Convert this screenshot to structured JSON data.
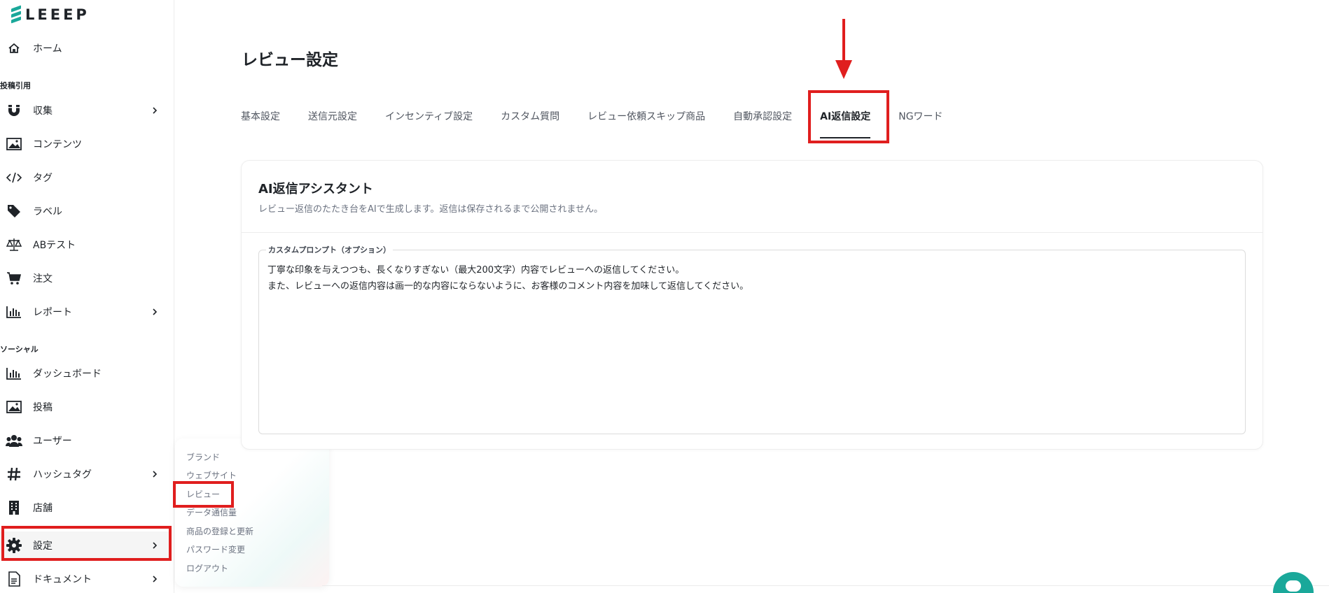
{
  "app": {
    "logo_text": "LEEEP"
  },
  "sidebar": {
    "home": "ホーム",
    "section_posts": "投稿引用",
    "collect": "収集",
    "contents": "コンテンツ",
    "tags": "タグ",
    "labels": "ラベル",
    "ab_test": "ABテスト",
    "orders": "注文",
    "reports": "レポート",
    "section_social": "ソーシャル",
    "dashboard": "ダッシュボード",
    "posts": "投稿",
    "users": "ユーザー",
    "hashtags": "ハッシュタグ",
    "stores": "店舗",
    "settings": "設定",
    "documents": "ドキュメント"
  },
  "submenu": {
    "items": [
      "ブランド",
      "ウェブサイト",
      "レビュー",
      "データ通信量",
      "商品の登録と更新",
      "パスワード変更",
      "ログアウト"
    ]
  },
  "page": {
    "title": "レビュー設定",
    "tabs": [
      "基本設定",
      "送信元設定",
      "インセンティブ設定",
      "カスタム質問",
      "レビュー依頼スキップ商品",
      "自動承認設定",
      "AI返信設定",
      "NGワード"
    ],
    "active_tab": "AI返信設定"
  },
  "card": {
    "title": "AI返信アシスタント",
    "description": "レビュー返信のたたき台をAIで生成します。返信は保存されるまで公開されません。",
    "prompt_label": "カスタムプロンプト（オプション）",
    "prompt_value": "丁寧な印象を与えつつも、長くなりすぎない（最大200文字）内容でレビューへの返信してください。\nまた、レビューへの返信内容は画一的な内容にならないように、お客様のコメント内容を加味して返信してください。"
  },
  "colors": {
    "accent": "#1aa89a",
    "highlight": "#e01e1e"
  }
}
